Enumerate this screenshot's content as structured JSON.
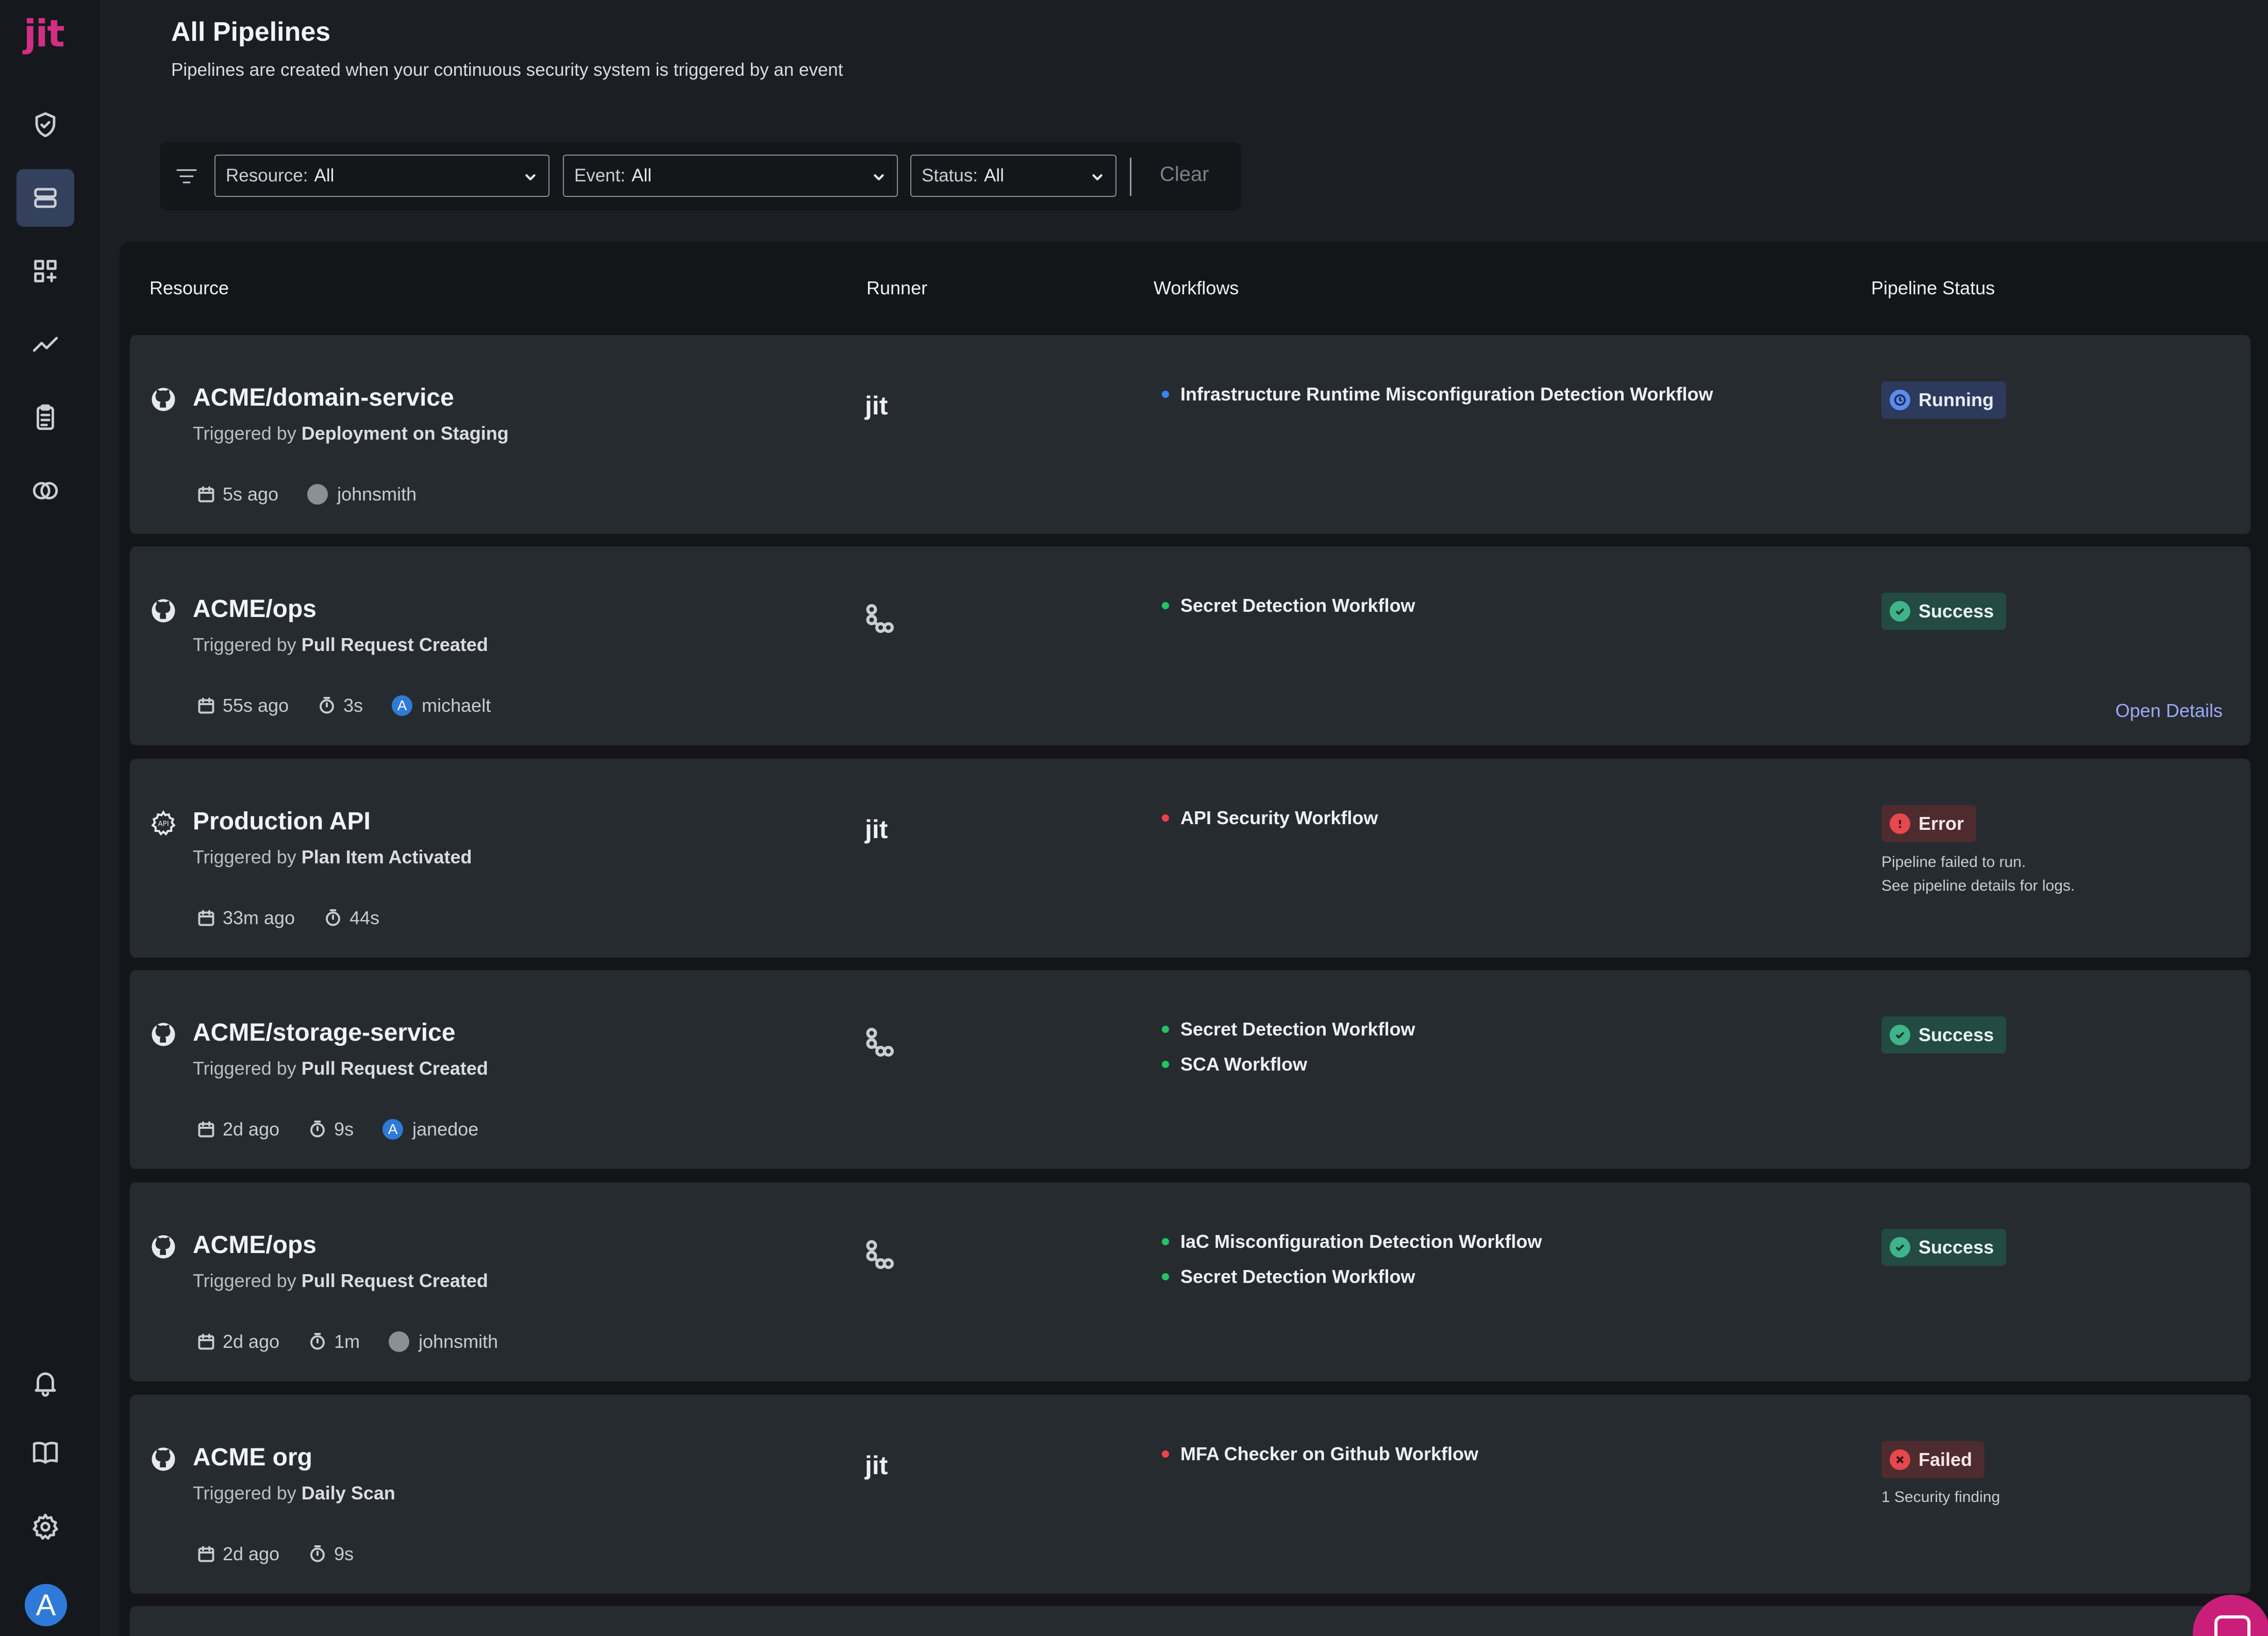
{
  "app": {
    "logo_text": "jit",
    "brand_color": "#d02f83"
  },
  "sidebar": {
    "items": [
      {
        "name": "shield-icon",
        "active": false
      },
      {
        "name": "pipelines-icon",
        "active": true
      },
      {
        "name": "integrations-icon",
        "active": false
      },
      {
        "name": "insights-icon",
        "active": false
      },
      {
        "name": "reports-icon",
        "active": false
      },
      {
        "name": "compliance-icon",
        "active": false
      }
    ],
    "bottom_items": [
      "bell-icon",
      "book-icon",
      "gear-icon"
    ],
    "user_avatar": "A"
  },
  "header": {
    "title": "All Pipelines",
    "subtitle": "Pipelines are created when your continuous security system is triggered by an event"
  },
  "filters": {
    "resource": {
      "label": "Resource:",
      "value": "All"
    },
    "event": {
      "label": "Event:",
      "value": "All"
    },
    "status": {
      "label": "Status:",
      "value": "All"
    },
    "clear_label": "Clear"
  },
  "table": {
    "columns": [
      "Resource",
      "Runner",
      "Workflows",
      "Pipeline Status"
    ],
    "rows": [
      {
        "resource": "ACME/domain-service",
        "resource_icon": "github-icon",
        "trigger_prefix": "Triggered by",
        "trigger": "Deployment on Staging",
        "time": "5s ago",
        "duration": "",
        "user": "johnsmith",
        "user_avatar": "photo",
        "runner": "jit",
        "workflows": [
          {
            "name": "Infrastructure Runtime Misconfiguration Detection Workflow",
            "color": "blue"
          }
        ],
        "status": "Running",
        "status_note": []
      },
      {
        "resource": "ACME/ops",
        "resource_icon": "github-icon",
        "trigger_prefix": "Triggered by",
        "trigger": "Pull Request Created",
        "time": "55s ago",
        "duration": "3s",
        "user": "michaelt",
        "user_avatar": "A",
        "runner": "github-actions",
        "workflows": [
          {
            "name": "Secret Detection Workflow",
            "color": "green"
          }
        ],
        "status": "Success",
        "status_note": [],
        "link": "Open Details"
      },
      {
        "resource": "Production API",
        "resource_icon": "api-gear-icon",
        "trigger_prefix": "Triggered by",
        "trigger": "Plan Item Activated",
        "time": "33m ago",
        "duration": "44s",
        "user": "",
        "runner": "jit",
        "workflows": [
          {
            "name": "API Security Workflow",
            "color": "red"
          }
        ],
        "status": "Error",
        "status_note": [
          "Pipeline failed to run.",
          "See pipeline details for logs."
        ]
      },
      {
        "resource": "ACME/storage-service",
        "resource_icon": "github-icon",
        "trigger_prefix": "Triggered by",
        "trigger": "Pull Request Created",
        "time": "2d ago",
        "duration": "9s",
        "user": "janedoe",
        "user_avatar": "A",
        "runner": "github-actions",
        "workflows": [
          {
            "name": "Secret Detection Workflow",
            "color": "green"
          },
          {
            "name": "SCA Workflow",
            "color": "green"
          }
        ],
        "status": "Success",
        "status_note": []
      },
      {
        "resource": "ACME/ops",
        "resource_icon": "github-icon",
        "trigger_prefix": "Triggered by",
        "trigger": "Pull Request Created",
        "time": "2d ago",
        "duration": "1m",
        "user": "johnsmith",
        "user_avatar": "photo",
        "runner": "github-actions",
        "workflows": [
          {
            "name": "IaC Misconfiguration Detection Workflow",
            "color": "green"
          },
          {
            "name": "Secret Detection Workflow",
            "color": "green"
          }
        ],
        "status": "Success",
        "status_note": []
      },
      {
        "resource": "ACME org",
        "resource_icon": "github-icon",
        "trigger_prefix": "Triggered by",
        "trigger": "Daily Scan",
        "time": "2d ago",
        "duration": "9s",
        "user": "",
        "runner": "jit",
        "workflows": [
          {
            "name": "MFA Checker on Github Workflow",
            "color": "red"
          }
        ],
        "status": "Failed",
        "status_note": [
          "1 Security finding"
        ]
      }
    ]
  },
  "status_colors": {
    "running": "#5b8cf0",
    "success": "#3fb38a",
    "error": "#e5484d"
  }
}
